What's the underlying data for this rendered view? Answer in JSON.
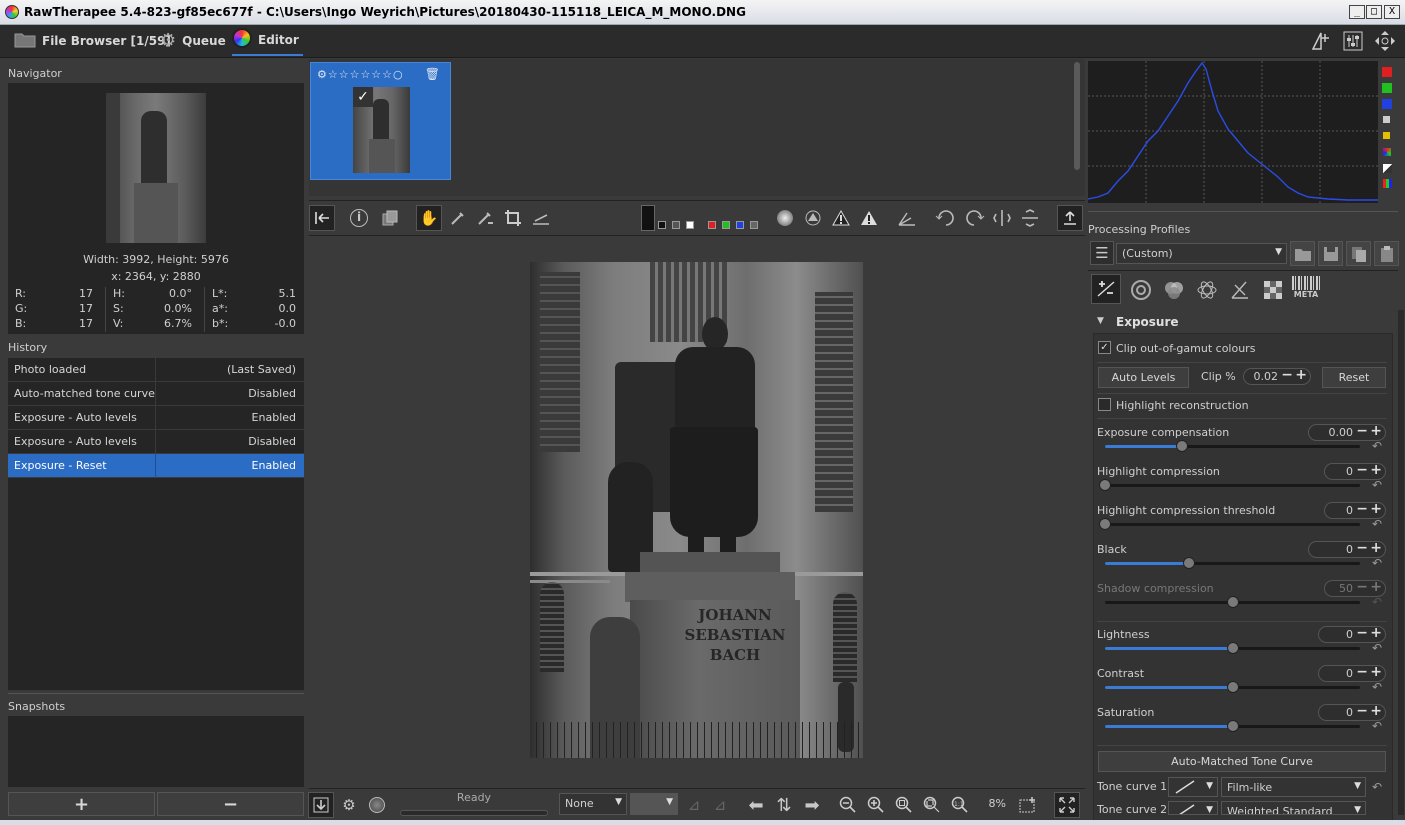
{
  "window": {
    "title": "RawTherapee 5.4-823-gf85ec677f - C:\\Users\\Ingo Weyrich\\Pictures\\20180430-115118_LEICA_M_MONO.DNG",
    "min_glyph": "_",
    "max_glyph": "□",
    "close_glyph": "X"
  },
  "tabs": {
    "file_browser": "File Browser [1/59]",
    "queue": "Queue",
    "editor": "Editor"
  },
  "navigator": {
    "title": "Navigator",
    "size": "Width: 3992, Height: 5976",
    "coords": "x: 2364, y: 2880",
    "rgb": [
      {
        "k": "R:",
        "v": "17"
      },
      {
        "k": "G:",
        "v": "17"
      },
      {
        "k": "B:",
        "v": "17"
      }
    ],
    "hsv": [
      {
        "k": "H:",
        "v": "0.0°"
      },
      {
        "k": "S:",
        "v": "0.0%"
      },
      {
        "k": "V:",
        "v": "6.7%"
      }
    ],
    "lab": [
      {
        "k": "L*:",
        "v": "5.1"
      },
      {
        "k": "a*:",
        "v": "0.0"
      },
      {
        "k": "b*:",
        "v": "-0.0"
      }
    ]
  },
  "history": {
    "title": "History",
    "rows": [
      {
        "action": "Photo loaded",
        "value": "(Last Saved)"
      },
      {
        "action": "Auto-matched tone curve",
        "value": "Disabled"
      },
      {
        "action": "Exposure - Auto levels",
        "value": "Enabled"
      },
      {
        "action": "Exposure - Auto levels",
        "value": "Disabled"
      },
      {
        "action": "Exposure - Reset",
        "value": "Enabled"
      }
    ],
    "selected_index": 4
  },
  "snapshots": {
    "title": "Snapshots",
    "add_glyph": "+",
    "remove_glyph": "−"
  },
  "status": {
    "text": "Ready",
    "zoom": "8%",
    "preview_mode": "None"
  },
  "profiles": {
    "title": "Processing Profiles",
    "selected": "(Custom)"
  },
  "tool_tabs": {
    "meta_label": "META"
  },
  "exposure": {
    "section_title": "Exposure",
    "clip_gamut_label": "Clip out-of-gamut colours",
    "clip_gamut_checked": true,
    "auto_levels_label": "Auto Levels",
    "clip_label": "Clip %",
    "clip_value": "0.02",
    "reset_label": "Reset",
    "highlight_recon_label": "Highlight reconstruction",
    "highlight_recon_checked": false,
    "sliders": [
      {
        "label": "Exposure compensation",
        "value": "0.00",
        "fraction": 0.3,
        "enabled": true
      },
      {
        "label": "Highlight compression",
        "value": "0",
        "fraction": 0.0,
        "enabled": true
      },
      {
        "label": "Highlight compression threshold",
        "value": "0",
        "fraction": 0.0,
        "enabled": true
      },
      {
        "label": "Black",
        "value": "0",
        "fraction": 0.33,
        "enabled": true
      },
      {
        "label": "Shadow compression",
        "value": "50",
        "fraction": 0.5,
        "enabled": false
      },
      {
        "label": "Lightness",
        "value": "0",
        "fraction": 0.5,
        "enabled": true
      },
      {
        "label": "Contrast",
        "value": "0",
        "fraction": 0.5,
        "enabled": true
      },
      {
        "label": "Saturation",
        "value": "0",
        "fraction": 0.5,
        "enabled": true
      }
    ],
    "tone_curve_button": "Auto-Matched Tone Curve",
    "tone_curve_1_label": "Tone curve 1:",
    "tone_curve_1_mode": "Film-like",
    "tone_curve_2_label": "Tone curve 2:",
    "tone_curve_2_mode": "Weighted Standard"
  },
  "image_text": {
    "line1": "JOHANN",
    "line2": "SEBASTIAN",
    "line3": "BACH"
  },
  "histogram_buttons": [
    {
      "name": "red",
      "color": "#e02020"
    },
    {
      "name": "green",
      "color": "#20c020"
    },
    {
      "name": "blue",
      "color": "#2040e0"
    },
    {
      "name": "luminance",
      "color": "#cccccc"
    },
    {
      "name": "chroma",
      "color": "#e0c000"
    }
  ]
}
